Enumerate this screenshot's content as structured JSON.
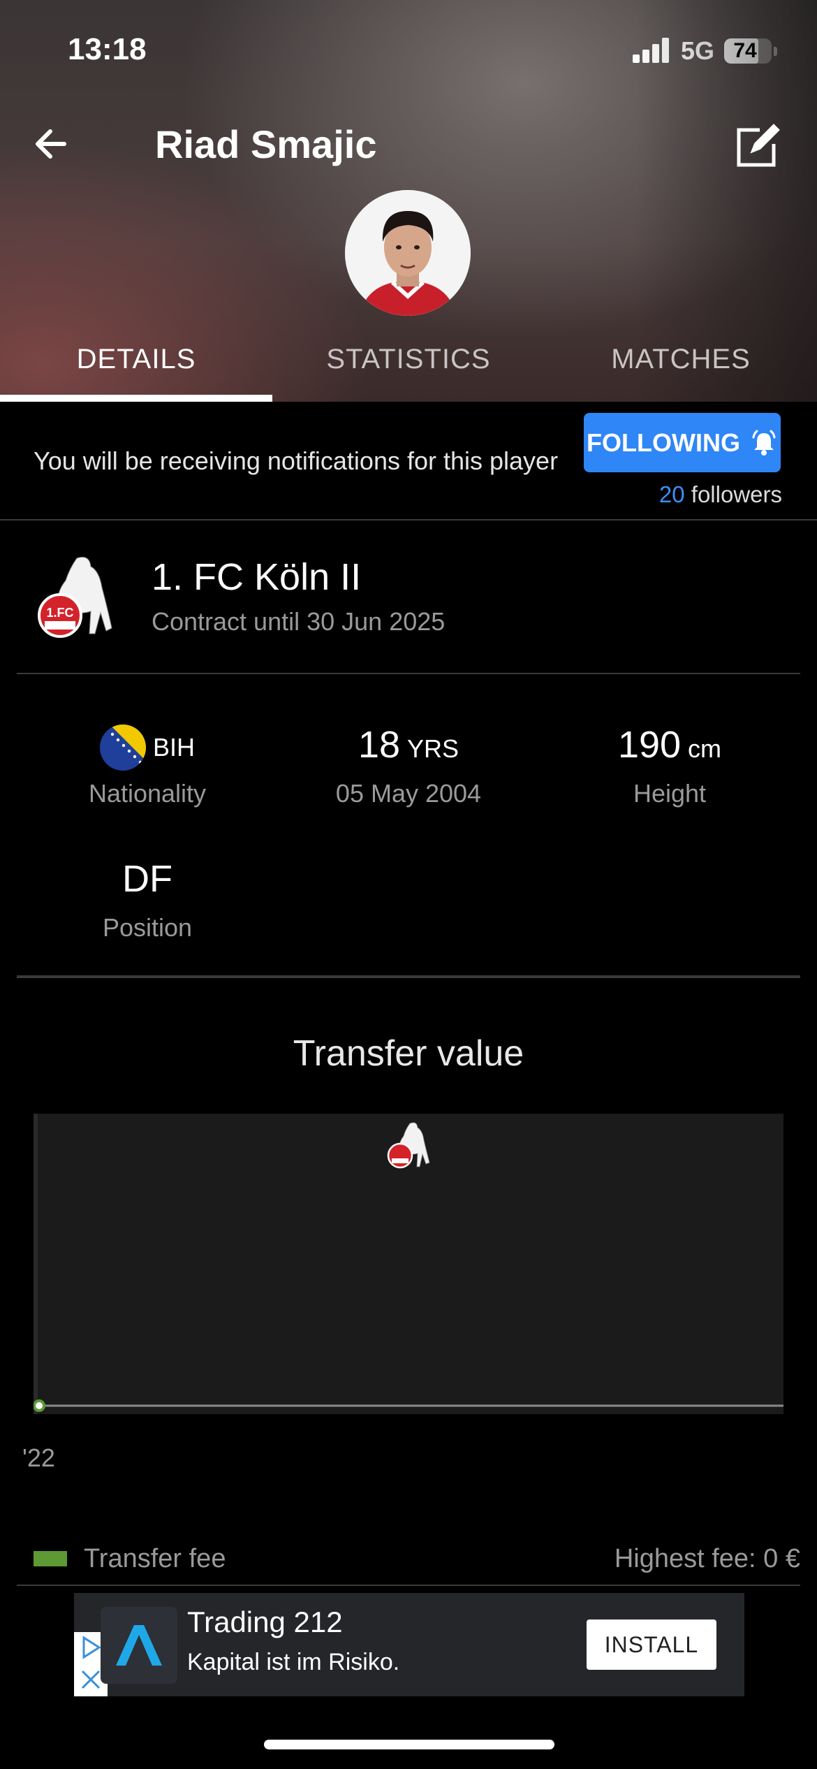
{
  "status_bar": {
    "time": "13:18",
    "network": "5G",
    "battery": "74"
  },
  "header": {
    "player_name": "Riad Smajic",
    "back_icon": "arrow-left-icon",
    "edit_icon": "edit-icon"
  },
  "tabs": [
    {
      "label": "DETAILS",
      "active": true
    },
    {
      "label": "STATISTICS",
      "active": false
    },
    {
      "label": "MATCHES",
      "active": false
    }
  ],
  "notification": {
    "text": "You will be receiving notifications for this player",
    "button_label": "FOLLOWING",
    "followers_count": "20",
    "followers_label": "followers"
  },
  "club": {
    "name": "1. FC Köln II",
    "contract": "Contract until 30 Jun 2025"
  },
  "info": {
    "nationality_code": "BIH",
    "nationality_label": "Nationality",
    "age_value": "18",
    "age_unit": "YRS",
    "birth_date": "05 May 2004",
    "height_value": "190",
    "height_unit": "cm",
    "height_label": "Height",
    "position_value": "DF",
    "position_label": "Position"
  },
  "transfer": {
    "title": "Transfer value",
    "year_label": "'22",
    "legend_label": "Transfer fee",
    "highest_fee": "Highest fee: 0 €"
  },
  "chart_data": {
    "type": "line",
    "title": "Transfer value",
    "x": [
      "'22"
    ],
    "series": [
      {
        "values": [
          0
        ]
      }
    ],
    "ylim": [
      0,
      1
    ],
    "grid": false
  },
  "ad": {
    "title": "Trading 212",
    "subtitle": "Kapital ist im Risiko.",
    "install_label": "INSTALL"
  },
  "colors": {
    "accent_blue": "#2f86f6",
    "legend_green": "#5d9a33",
    "background": "#000000",
    "muted_text": "#9a9a9a"
  }
}
